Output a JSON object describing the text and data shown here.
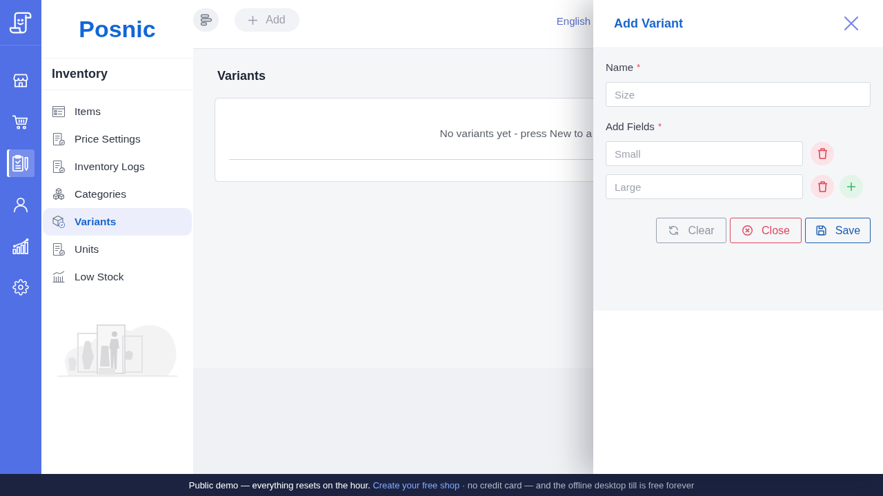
{
  "rail": {
    "items": [
      {
        "kind": "store",
        "selected": false
      },
      {
        "kind": "cart",
        "selected": false
      },
      {
        "kind": "clipboard",
        "selected": true
      },
      {
        "kind": "user",
        "selected": false
      },
      {
        "kind": "chart",
        "selected": false
      },
      {
        "kind": "gear",
        "selected": false
      }
    ]
  },
  "sidebar": {
    "brand": "Posnic",
    "section_title": "Inventory",
    "items": [
      {
        "label": "Items",
        "kind": "list",
        "selected": false
      },
      {
        "label": "Price Settings",
        "kind": "doc",
        "selected": false
      },
      {
        "label": "Inventory Logs",
        "kind": "doc",
        "selected": false
      },
      {
        "label": "Categories",
        "kind": "cubes",
        "selected": false
      },
      {
        "label": "Variants",
        "kind": "box",
        "selected": true
      },
      {
        "label": "Units",
        "kind": "doc",
        "selected": false
      },
      {
        "label": "Low Stock",
        "kind": "bars",
        "selected": false
      }
    ]
  },
  "header": {
    "add_button": "Add",
    "language": "English"
  },
  "page": {
    "title": "Variants",
    "empty_message": "No variants yet - press New to a"
  },
  "drawer": {
    "title": "Add Variant",
    "name": {
      "label": "Name",
      "required_mark": "*",
      "placeholder": "Size"
    },
    "fields": {
      "label": "Add Fields",
      "required_mark": "*",
      "rows": [
        {
          "placeholder": "Small",
          "add_button": false
        },
        {
          "placeholder": "Large",
          "add_button": true
        }
      ]
    },
    "buttons": [
      {
        "label": "Clear",
        "kind": "clear"
      },
      {
        "label": "Close",
        "kind": "close"
      },
      {
        "label": "Save",
        "kind": "save"
      }
    ]
  },
  "banner": {
    "text": "Public demo — everything resets on the hour.",
    "link": "Create your free shop",
    "note": "· no credit card — and the offline desktop till is free forever"
  }
}
